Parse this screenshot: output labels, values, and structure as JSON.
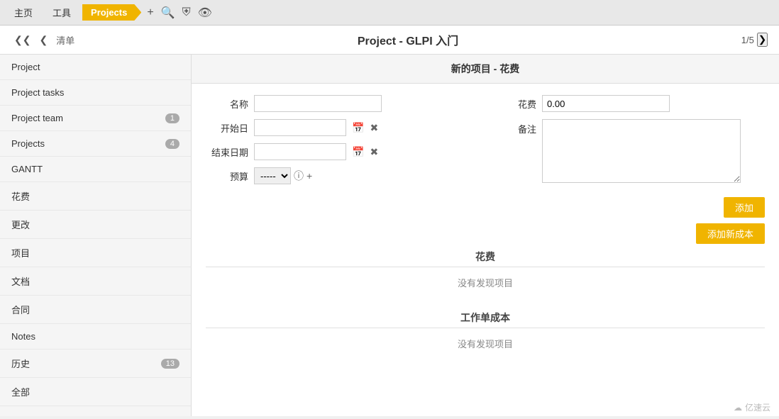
{
  "topnav": {
    "items": [
      {
        "label": "主页",
        "active": false
      },
      {
        "label": "工具",
        "active": false
      },
      {
        "label": "Projects",
        "active": true
      }
    ],
    "icons": [
      {
        "name": "plus-icon",
        "symbol": "+"
      },
      {
        "name": "search-icon",
        "symbol": "🔍"
      },
      {
        "name": "branch-icon",
        "symbol": "⑥"
      },
      {
        "name": "eye-icon",
        "symbol": "👁"
      }
    ]
  },
  "breadcrumb": {
    "list_label": "清单",
    "title": "Project - GLPI 入门",
    "pagination": "1/5"
  },
  "sidebar": {
    "items": [
      {
        "label": "Project",
        "badge": null
      },
      {
        "label": "Project tasks",
        "badge": null
      },
      {
        "label": "Project team",
        "badge": "1"
      },
      {
        "label": "Projects",
        "badge": "4"
      },
      {
        "label": "GANTT",
        "badge": null
      },
      {
        "label": "花费",
        "badge": null
      },
      {
        "label": "更改",
        "badge": null
      },
      {
        "label": "项目",
        "badge": null
      },
      {
        "label": "文档",
        "badge": null
      },
      {
        "label": "合同",
        "badge": null
      },
      {
        "label": "Notes",
        "badge": null
      },
      {
        "label": "历史",
        "badge": "13"
      },
      {
        "label": "全部",
        "badge": null
      }
    ]
  },
  "form": {
    "header": "新的项目 - 花费",
    "fields": {
      "name_label": "名称",
      "name_value": "",
      "cost_label": "花费",
      "cost_value": "0.00",
      "start_label": "开始日",
      "start_value": "",
      "end_label": "结束日期",
      "end_value": "",
      "budget_label": "预算",
      "budget_value": "-----",
      "comment_label": "备注",
      "comment_value": ""
    },
    "add_button": "添加",
    "add_cost_button": "添加新成本"
  },
  "sections": {
    "cost_title": "花费",
    "no_items_1": "没有发现项目",
    "work_order_cost_title": "工作单成本",
    "no_items_2": "没有发现项目"
  },
  "watermark": {
    "icon": "☁",
    "text": "亿速云"
  }
}
